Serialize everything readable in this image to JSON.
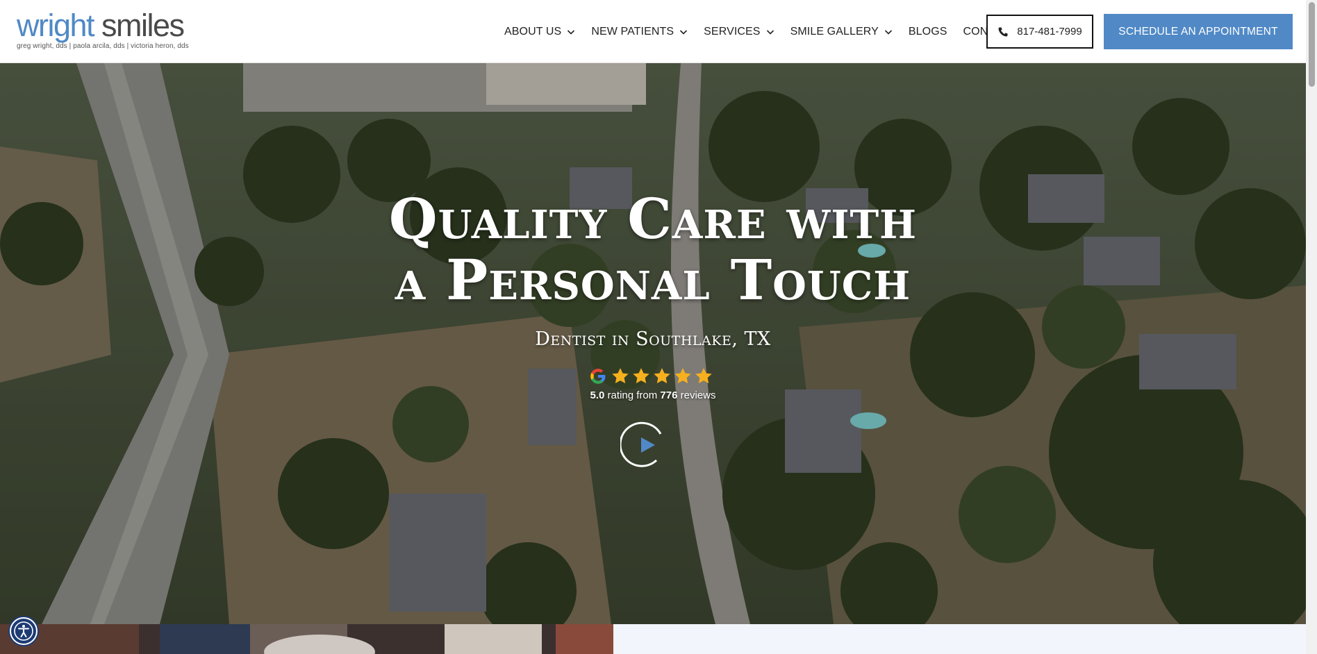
{
  "logo": {
    "word_part1": "wright",
    "word_part2": " smiles",
    "tagline": "greg wright, dds | paola arcila, dds | victoria heron, dds"
  },
  "nav": {
    "about": "ABOUT US",
    "new_patients": "NEW PATIENTS",
    "services": "SERVICES",
    "gallery": "SMILE GALLERY",
    "blogs": "BLOGS",
    "contact": "CONTACT"
  },
  "cta": {
    "phone": "817-481-7999",
    "schedule": "SCHEDULE AN APPOINTMENT"
  },
  "hero": {
    "title_line1": "Quality Care with",
    "title_line2": "a Personal Touch",
    "subtitle": "Dentist in Southlake, TX",
    "rating_value": "5.0",
    "rating_mid": " rating from ",
    "review_count": "776",
    "rating_suffix": " reviews",
    "stars": 5
  },
  "colors": {
    "brand_blue": "#5089c6",
    "star_gold": "#f6b01e",
    "a11y_navy": "#1d3b73"
  },
  "icons": [
    "chevron-down-icon",
    "phone-icon",
    "google-icon",
    "star-icon",
    "play-icon",
    "accessibility-icon"
  ]
}
